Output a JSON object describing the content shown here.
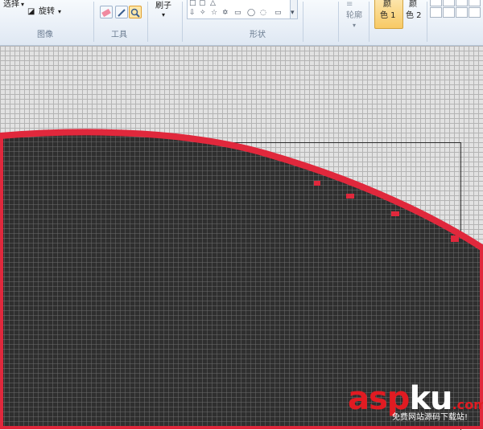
{
  "ribbon": {
    "select_label": "选择",
    "rotate_label": "旋转",
    "image_group": "图像",
    "tools_group": "工具",
    "brushes_label": "刷子",
    "shapes_group": "形状",
    "outline_label": "轮廓",
    "color1_line1": "颜",
    "color1_line2": "色 1",
    "color2_line1": "颜",
    "color2_line2": "色 2"
  },
  "colors": {
    "stroke": "#e0283c",
    "fill": "#2f2f2f",
    "canvas_bg": "#e2e2e2"
  },
  "watermark": {
    "brand_a": "asp",
    "brand_b": "ku",
    "brand_c": ".com",
    "subtitle": "免费网站源码下载站!"
  }
}
